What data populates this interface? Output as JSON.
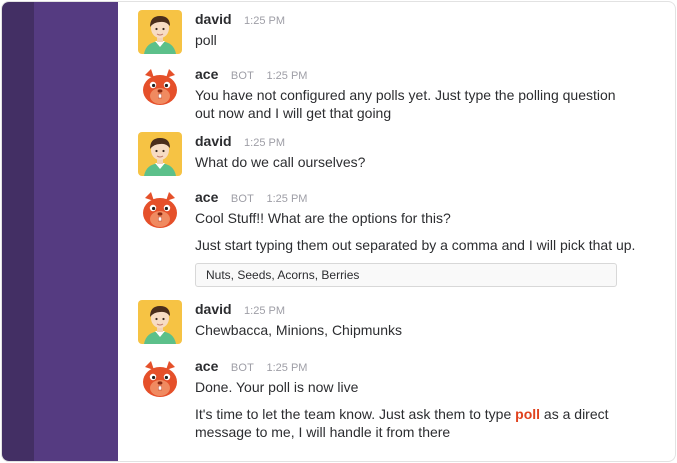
{
  "messages": [
    {
      "author": "david",
      "time": "1:25 PM",
      "lines": [
        "poll"
      ]
    },
    {
      "author": "ace",
      "bot_tag": "BOT",
      "time": "1:25 PM",
      "lines": [
        "You have not configured any polls yet. Just type the polling question",
        "out now and I will get that going"
      ]
    },
    {
      "author": "david",
      "time": "1:25 PM",
      "lines": [
        "What do we call ourselves?"
      ]
    },
    {
      "author": "ace",
      "bot_tag": "BOT",
      "time": "1:25 PM",
      "lines": [
        "Cool Stuff!! What are the options for this?"
      ],
      "second": "Just start typing them out separated by a comma and I will pick that up.",
      "box": "Nuts, Seeds, Acorns, Berries"
    },
    {
      "author": "david",
      "time": "1:25 PM",
      "lines": [
        "Chewbacca, Minions, Chipmunks"
      ]
    },
    {
      "author": "ace",
      "bot_tag": "BOT",
      "time": "1:25 PM",
      "lines": [
        "Done. Your poll is now live"
      ],
      "second_pre": "It's time to let the team know. Just ask them to type ",
      "second_hl": "poll",
      "second_post": " as a direct",
      "second_line2": "message to me, I will handle it from there"
    }
  ],
  "colors": {
    "sidebar": "#553b81",
    "sidebar_edge": "#432f64",
    "highlight": "#e0421e"
  },
  "icons": {
    "user_avatar": "user-avatar-icon",
    "bot_avatar": "squirrel-bot-icon"
  }
}
